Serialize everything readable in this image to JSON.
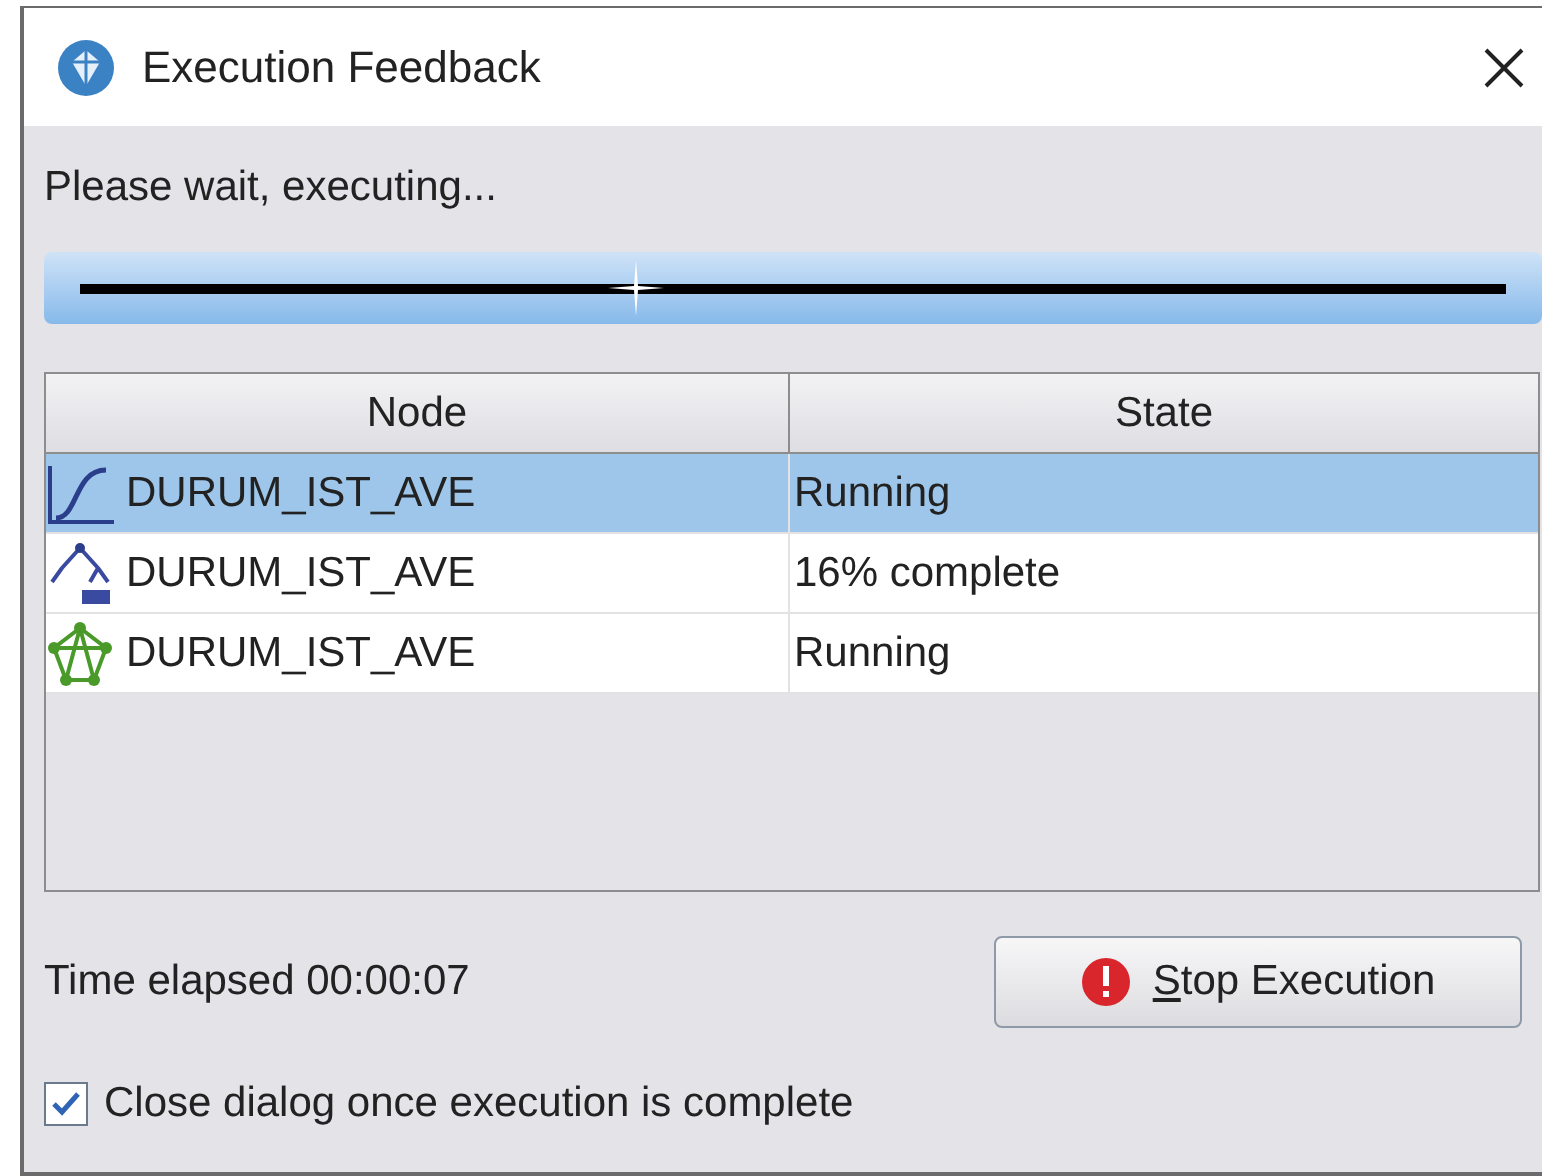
{
  "window": {
    "title": "Execution Feedback"
  },
  "message": "Please wait, executing...",
  "progress": {
    "indeterminate": true
  },
  "table": {
    "columns": [
      "Node",
      "State"
    ],
    "rows": [
      {
        "node": "DURUM_IST_AVE",
        "state": "Running",
        "selected": true
      },
      {
        "node": "DURUM_IST_AVE",
        "state": "16% complete",
        "selected": false
      },
      {
        "node": "DURUM_IST_AVE",
        "state": "Running",
        "selected": false
      }
    ]
  },
  "time_elapsed": "Time elapsed 00:00:07",
  "stop_button": "Stop Execution",
  "close_checkbox": {
    "label": "Close dialog once execution is complete",
    "checked": true
  }
}
